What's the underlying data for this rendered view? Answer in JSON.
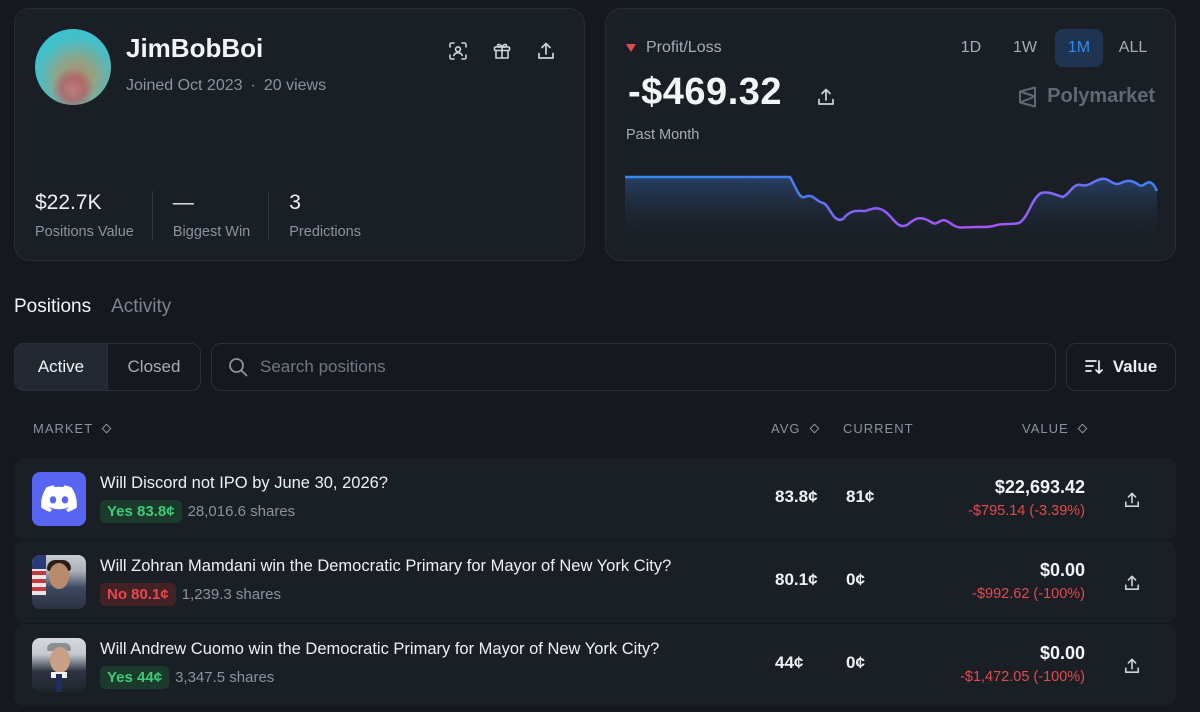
{
  "profile": {
    "username": "JimBobBoi",
    "joined": "Joined Oct 2023",
    "separator": "·",
    "views": "20 views",
    "stats": [
      {
        "value": "$22.7K",
        "label": "Positions Value"
      },
      {
        "value": "—",
        "label": "Biggest Win"
      },
      {
        "value": "3",
        "label": "Predictions"
      }
    ]
  },
  "pnl": {
    "label": "Profit/Loss",
    "value": "-$469.32",
    "period": "Past Month",
    "brand": "Polymarket",
    "ranges": [
      "1D",
      "1W",
      "1M",
      "ALL"
    ],
    "active_range": "1M",
    "colors": {
      "line_start": "#2f8cf0",
      "line_end": "#a855f7",
      "down_marker": "#e5484d"
    }
  },
  "tabs": {
    "positions": "Positions",
    "activity": "Activity"
  },
  "filters": {
    "active": "Active",
    "closed": "Closed",
    "search_placeholder": "Search positions",
    "sort_label": "Value"
  },
  "table": {
    "headers": {
      "market": "MARKET",
      "avg": "AVG",
      "current": "CURRENT",
      "value": "VALUE"
    },
    "rows": [
      {
        "question": "Will Discord not IPO by June 30, 2026?",
        "outcome": "Yes 83.8¢",
        "shares": "28,016.6 shares",
        "avg": "83.8¢",
        "current": "81¢",
        "value": "$22,693.42",
        "change": "-$795.14 (-3.39%)"
      },
      {
        "question": "Will Zohran Mamdani win the Democratic Primary for Mayor of New York City?",
        "outcome": "No 80.1¢",
        "shares": "1,239.3 shares",
        "avg": "80.1¢",
        "current": "0¢",
        "value": "$0.00",
        "change": "-$992.62 (-100%)"
      },
      {
        "question": "Will Andrew Cuomo win the Democratic Primary for Mayor of New York City?",
        "outcome": "Yes 44¢",
        "shares": "3,347.5 shares",
        "avg": "44¢",
        "current": "0¢",
        "value": "$0.00",
        "change": "-$1,472.05 (-100%)"
      }
    ]
  }
}
